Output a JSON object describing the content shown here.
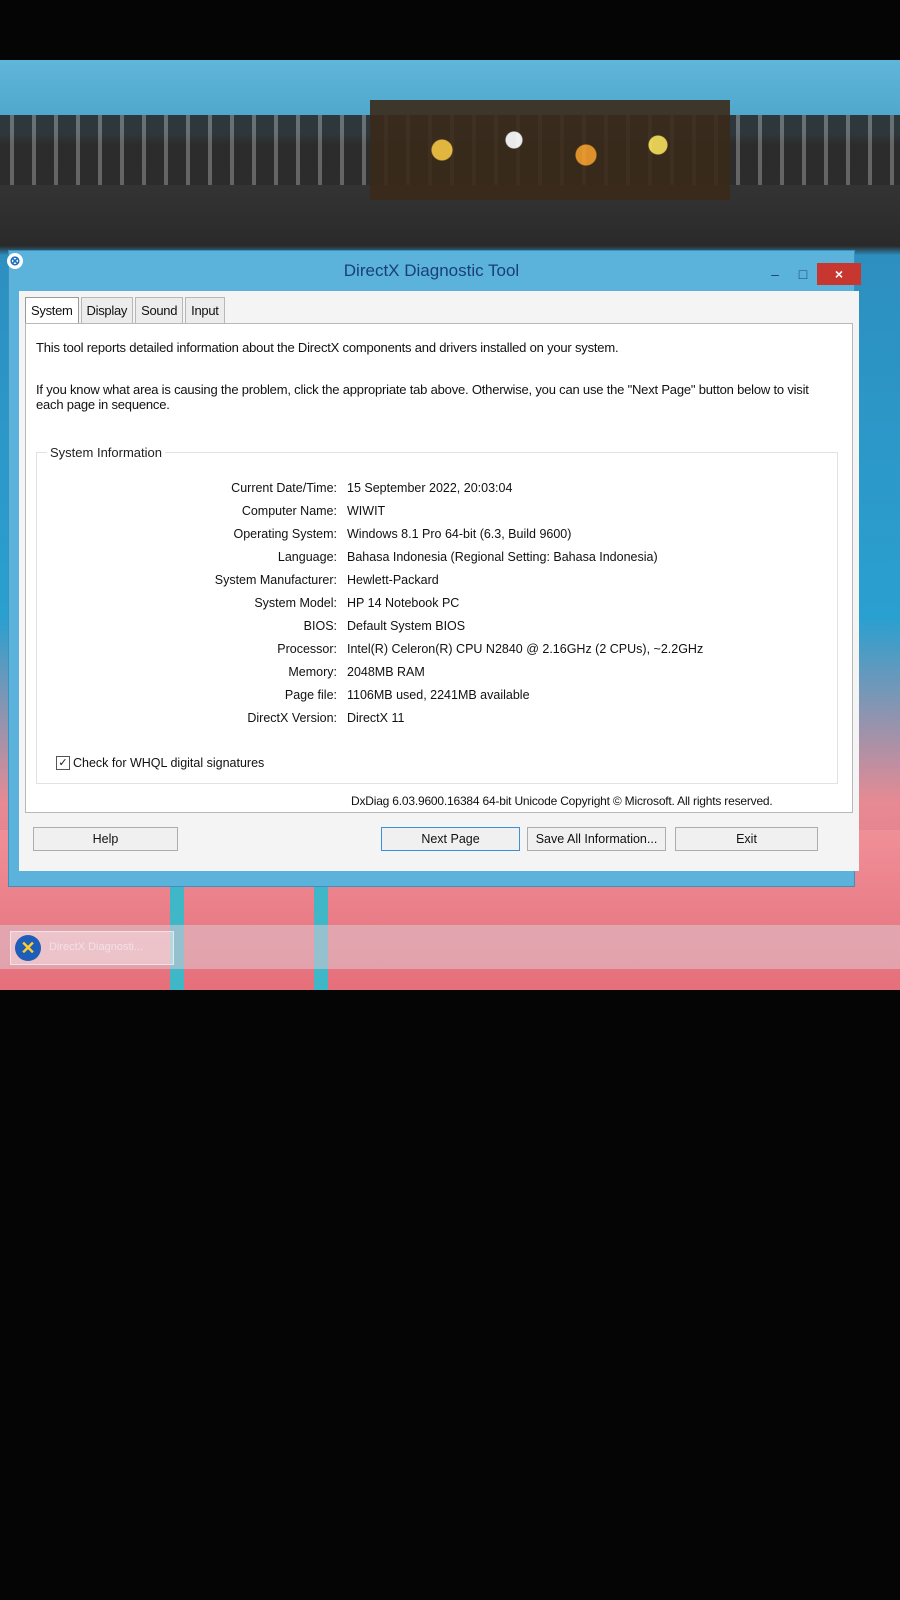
{
  "window": {
    "title": "DirectX Diagnostic Tool",
    "close_glyph": "×",
    "min_glyph": "–",
    "max_glyph": "□"
  },
  "tabs": [
    "System",
    "Display",
    "Sound",
    "Input"
  ],
  "intro": "This tool reports detailed information about the DirectX components and drivers installed on your system.",
  "intro2": "If you know what area is causing the problem, click the appropriate tab above.  Otherwise, you can use the \"Next Page\" button below to visit each page in sequence.",
  "system_info": {
    "group_label": "System Information",
    "rows": [
      {
        "label": "Current Date/Time:",
        "value": "15 September 2022, 20:03:04"
      },
      {
        "label": "Computer Name:",
        "value": "WIWIT"
      },
      {
        "label": "Operating System:",
        "value": "Windows 8.1 Pro 64-bit (6.3, Build 9600)"
      },
      {
        "label": "Language:",
        "value": "Bahasa Indonesia (Regional Setting: Bahasa Indonesia)"
      },
      {
        "label": "System Manufacturer:",
        "value": "Hewlett-Packard"
      },
      {
        "label": "System Model:",
        "value": "HP 14 Notebook PC"
      },
      {
        "label": "BIOS:",
        "value": "Default System BIOS"
      },
      {
        "label": "Processor:",
        "value": "Intel(R) Celeron(R) CPU  N2840  @ 2.16GHz (2 CPUs), ~2.2GHz"
      },
      {
        "label": "Memory:",
        "value": "2048MB RAM"
      },
      {
        "label": "Page file:",
        "value": "1106MB used, 2241MB available"
      },
      {
        "label": "DirectX Version:",
        "value": "DirectX 11"
      }
    ]
  },
  "whql": {
    "label": "Check for WHQL digital signatures",
    "checked_glyph": "✓"
  },
  "copyright": "DxDiag 6.03.9600.16384 64-bit Unicode  Copyright © Microsoft. All rights reserved.",
  "buttons": {
    "help": "Help",
    "next": "Next Page",
    "save": "Save All Information...",
    "exit": "Exit"
  },
  "taskbar": {
    "item_label": "DirectX Diagnosti..."
  }
}
